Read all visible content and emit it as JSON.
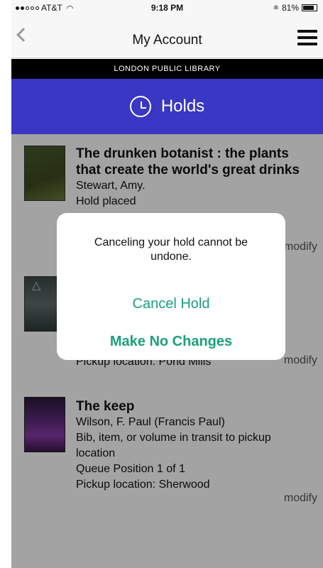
{
  "status_bar": {
    "carrier": "AT&T",
    "time": "9:18 PM",
    "battery": "81%",
    "battery_level": 0.81,
    "icons": [
      "wifi-icon",
      "bluetooth-icon",
      "battery-icon"
    ]
  },
  "nav": {
    "title": "My Account",
    "back_icon": "chevron-left-icon",
    "menu_icon": "hamburger-menu-icon"
  },
  "banner": {
    "text": "LONDON PUBLIC LIBRARY"
  },
  "section": {
    "title": "Holds",
    "icon": "clock-icon",
    "color": "#3a37c4"
  },
  "holds": [
    {
      "title_line1": "The drunken botanist : the plants",
      "title_line2": "that create the world's great drinks",
      "author": "Stewart, Amy.",
      "status": "Hold placed",
      "modify": "modify"
    },
    {
      "pickup": "Pickup location: Pond Mills",
      "modify": "modify"
    },
    {
      "title": "The keep",
      "author": "Wilson, F. Paul (Francis Paul)",
      "status_line1": "Bib, item, or volume in transit to pickup",
      "status_line2": "location",
      "queue": "Queue Position 1 of 1",
      "pickup": "Pickup location: Sherwood",
      "modify": "modify"
    }
  ],
  "alert": {
    "message_line1": "Canceling your hold cannot be",
    "message_line2": "undone.",
    "cancel_label": "Cancel Hold",
    "keep_label": "Make No Changes",
    "button_color": "#1aa17c"
  }
}
